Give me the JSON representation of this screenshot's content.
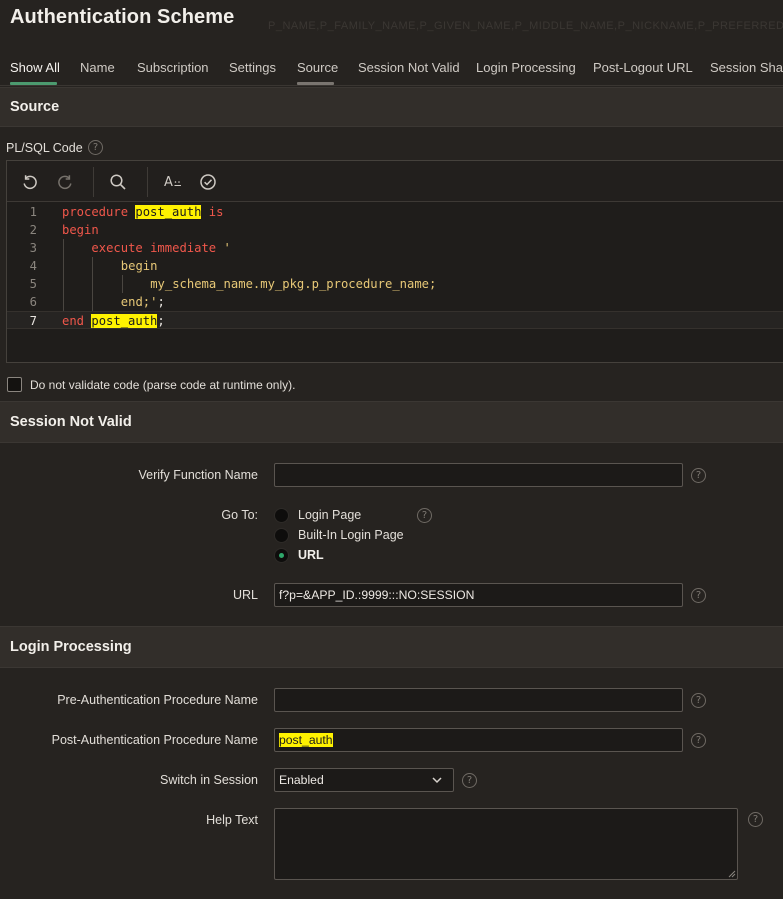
{
  "header": {
    "title": "Authentication Scheme",
    "ghost": "P_NAME,P_FAMILY_NAME,P_GIVEN_NAME,P_MIDDLE_NAME,P_NICKNAME,P_PREFERRED"
  },
  "tabs": [
    {
      "label": "Show All",
      "active": true
    },
    {
      "label": "Name"
    },
    {
      "label": "Subscription"
    },
    {
      "label": "Settings"
    },
    {
      "label": "Source"
    },
    {
      "label": "Session Not Valid"
    },
    {
      "label": "Login Processing"
    },
    {
      "label": "Post-Logout URL"
    },
    {
      "label": "Session Shari"
    }
  ],
  "colors": {
    "active_tab_underline": "#4c9a6f",
    "source_tab_underline": "#7a7570",
    "highlight": "#fff200",
    "keyword": "#f0574b",
    "string": "#e7c877"
  },
  "source": {
    "section_title": "Source",
    "plsql_label": "PL/SQL Code",
    "help_glyph": "?",
    "toolbar_icons": [
      "undo-icon",
      "redo-icon",
      "search-icon",
      "autocomplete-icon",
      "validate-icon"
    ],
    "autocomplete_text": "A",
    "code_lines": [
      {
        "n": "1",
        "indent": 0,
        "parts": [
          {
            "t": "procedure ",
            "c": "kw"
          },
          {
            "t": "post_auth",
            "c": "hl"
          },
          {
            "t": " is",
            "c": "kw"
          }
        ]
      },
      {
        "n": "2",
        "indent": 0,
        "parts": [
          {
            "t": "begin",
            "c": "kw"
          }
        ]
      },
      {
        "n": "3",
        "indent": 1,
        "parts": [
          {
            "t": "execute immediate ",
            "c": "kw"
          },
          {
            "t": "'",
            "c": "str"
          }
        ]
      },
      {
        "n": "4",
        "indent": 2,
        "parts": [
          {
            "t": "begin",
            "c": "str"
          }
        ]
      },
      {
        "n": "5",
        "indent": 3,
        "parts": [
          {
            "t": "my_schema_name.my_pkg.p_procedure_name;",
            "c": "str"
          }
        ]
      },
      {
        "n": "6",
        "indent": 2,
        "parts": [
          {
            "t": "end;'",
            "c": "str"
          },
          {
            "t": ";",
            "c": "plain"
          }
        ]
      },
      {
        "n": "7",
        "indent": 0,
        "current": true,
        "parts": [
          {
            "t": "end ",
            "c": "kw"
          },
          {
            "t": "post_auth",
            "c": "hl"
          },
          {
            "t": ";",
            "c": "plain"
          }
        ]
      }
    ],
    "no_validate_label": "Do not validate code (parse code at runtime only).",
    "no_validate_checked": false
  },
  "session_not_valid": {
    "section_title": "Session Not Valid",
    "verify_label": "Verify Function Name",
    "verify_value": "",
    "goto_label": "Go To:",
    "goto_options": [
      "Login Page",
      "Built-In Login Page",
      "URL"
    ],
    "goto_selected": "URL",
    "url_label": "URL",
    "url_value": "f?p=&APP_ID.:9999:::NO:SESSION"
  },
  "login_processing": {
    "section_title": "Login Processing",
    "pre_auth_label": "Pre-Authentication Procedure Name",
    "pre_auth_value": "",
    "post_auth_label": "Post-Authentication Procedure Name",
    "post_auth_value": "post_auth",
    "switch_label": "Switch in Session",
    "switch_value": "Enabled",
    "help_text_label": "Help Text",
    "help_text_value": ""
  }
}
